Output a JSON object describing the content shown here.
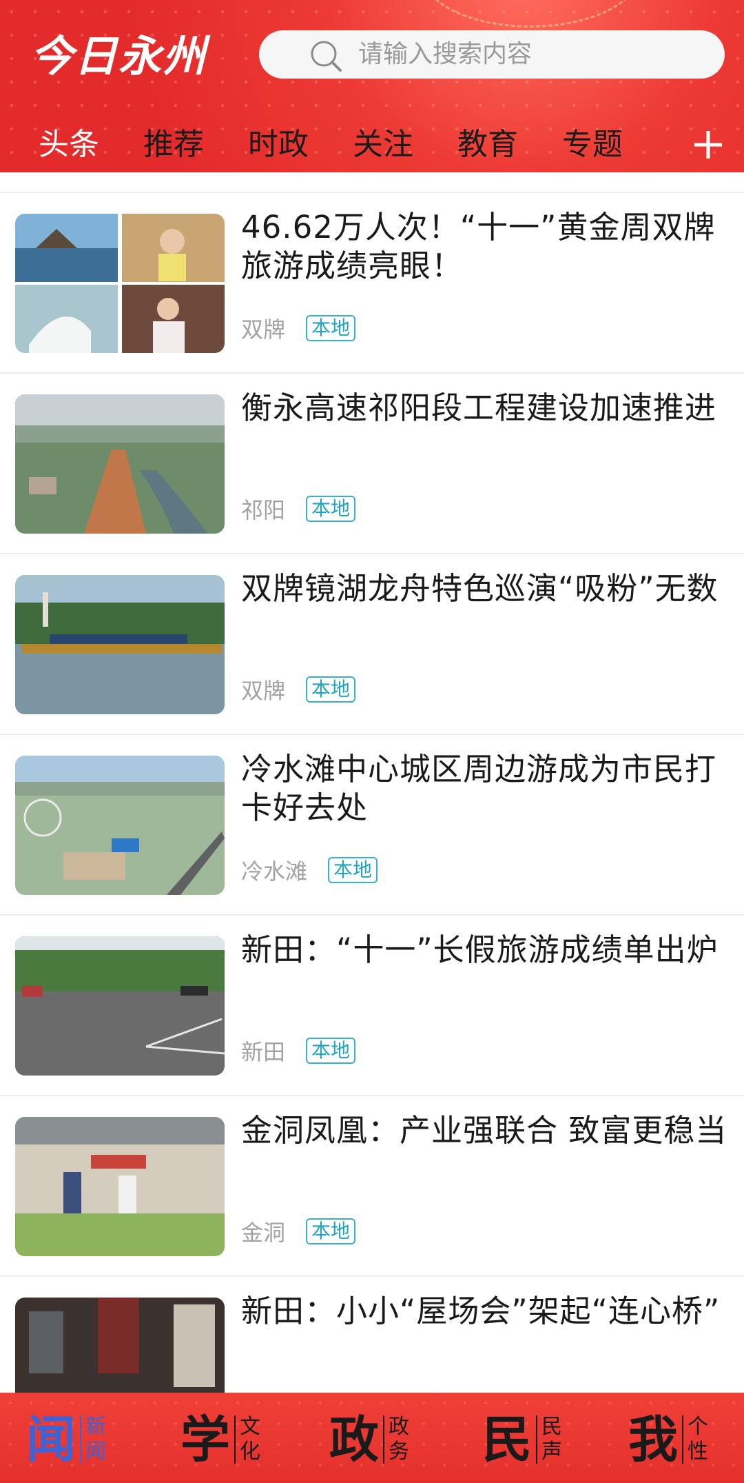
{
  "header": {
    "logo": "今日永州",
    "search_placeholder": "请输入搜索内容",
    "tabs": [
      {
        "label": "头条",
        "active": true
      },
      {
        "label": "推荐",
        "active": false
      },
      {
        "label": "时政",
        "active": false
      },
      {
        "label": "关注",
        "active": false
      },
      {
        "label": "教育",
        "active": false
      },
      {
        "label": "专题",
        "active": false
      }
    ]
  },
  "feed": [
    {
      "title": "46.62万人次！“十一”黄金周双牌旅游成绩亮眼！",
      "source": "双牌",
      "tag": "本地"
    },
    {
      "title": "衡永高速祁阳段工程建设加速推进",
      "source": "祁阳",
      "tag": "本地"
    },
    {
      "title": "双牌镜湖龙舟特色巡演“吸粉”无数",
      "source": "双牌",
      "tag": "本地"
    },
    {
      "title": "冷水滩中心城区周边游成为市民打卡好去处",
      "source": "冷水滩",
      "tag": "本地"
    },
    {
      "title": "新田：“十一”长假旅游成绩单出炉",
      "source": "新田",
      "tag": "本地"
    },
    {
      "title": "金洞凤凰：产业强联合 致富更稳当",
      "source": "金洞",
      "tag": "本地"
    },
    {
      "title": "新田：小小“屋场会”架起“连心桥”",
      "source": "",
      "tag": ""
    }
  ],
  "bottom_nav": [
    {
      "big": "闻",
      "small": "新闻",
      "active": true
    },
    {
      "big": "学",
      "small": "文化",
      "active": false
    },
    {
      "big": "政",
      "small": "政务",
      "active": false
    },
    {
      "big": "民",
      "small": "民声",
      "active": false
    },
    {
      "big": "我",
      "small": "个性",
      "active": false
    }
  ],
  "colors": {
    "brand_red": "#e32b2b",
    "tag_blue": "#20a3c5",
    "nav_active": "#3e63d6"
  }
}
